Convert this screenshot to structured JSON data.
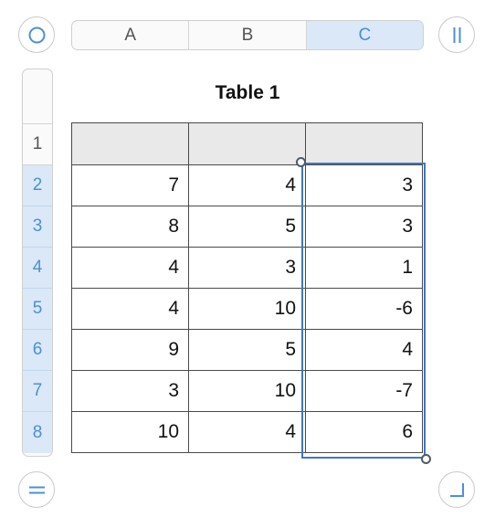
{
  "column_headers": [
    "A",
    "B",
    "C"
  ],
  "selected_column": "C",
  "row_headers": [
    "1",
    "2",
    "3",
    "4",
    "5",
    "6",
    "7",
    "8"
  ],
  "selected_rows": [
    "2",
    "3",
    "4",
    "5",
    "6",
    "7",
    "8"
  ],
  "table": {
    "title": "Table 1",
    "header_row": [
      "",
      "",
      ""
    ],
    "rows": [
      [
        "7",
        "4",
        "3"
      ],
      [
        "8",
        "5",
        "3"
      ],
      [
        "4",
        "3",
        "1"
      ],
      [
        "4",
        "10",
        "-6"
      ],
      [
        "9",
        "5",
        "4"
      ],
      [
        "3",
        "10",
        "-7"
      ],
      [
        "10",
        "4",
        "6"
      ]
    ]
  },
  "icons": {
    "top_left": "circle-icon",
    "top_right": "pause-bars-icon",
    "bottom_left": "equals-icon",
    "bottom_right": "resize-corner-icon"
  },
  "colors": {
    "accent": "#4a90d9",
    "selection_border": "#3f78c0",
    "selected_header_bg": "#dbe8f7",
    "header_row_bg": "#e9e9e9"
  }
}
